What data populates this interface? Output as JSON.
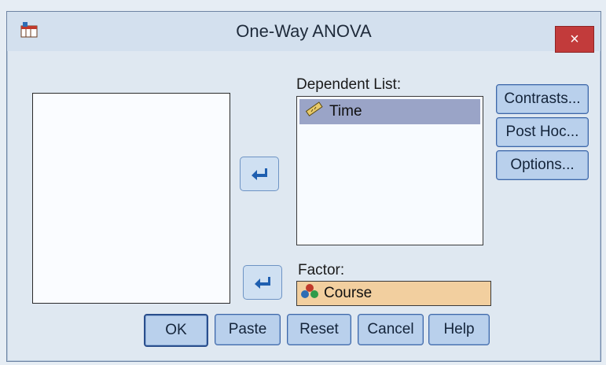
{
  "window": {
    "title": "One-Way ANOVA",
    "close_label": "×"
  },
  "dependent": {
    "label": "Dependent List:",
    "items": [
      {
        "name": "Time",
        "icon": "ruler-scale-icon"
      }
    ]
  },
  "factor": {
    "label": "Factor:",
    "value": "Course",
    "icon": "nominal-variable-icon"
  },
  "side_buttons": {
    "contrasts": "Contrasts...",
    "post_hoc": "Post Hoc...",
    "options": "Options..."
  },
  "bottom_buttons": {
    "ok": "OK",
    "paste": "Paste",
    "reset": "Reset",
    "cancel": "Cancel",
    "help": "Help"
  },
  "colors": {
    "selection": "#9aa4c7",
    "factor_bg": "#f2cf9f",
    "button_bg": "#b9d0ec",
    "close_bg": "#c23b3b"
  }
}
